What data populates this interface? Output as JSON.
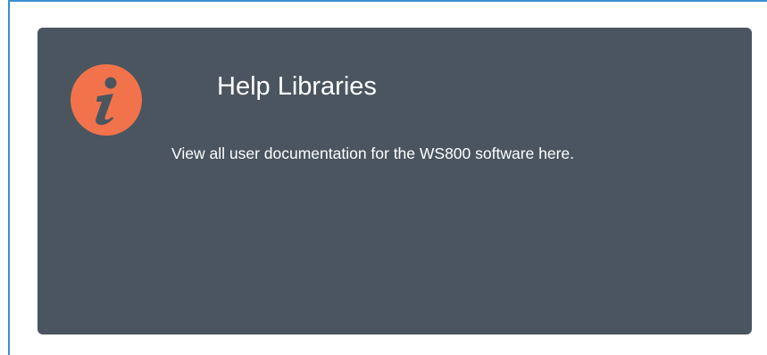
{
  "card": {
    "title": "Help Libraries",
    "description": "View all user documentation for the WS800 software here.",
    "icon": "info-icon",
    "background_color": "#4a5560",
    "icon_color": "#f2734b"
  }
}
